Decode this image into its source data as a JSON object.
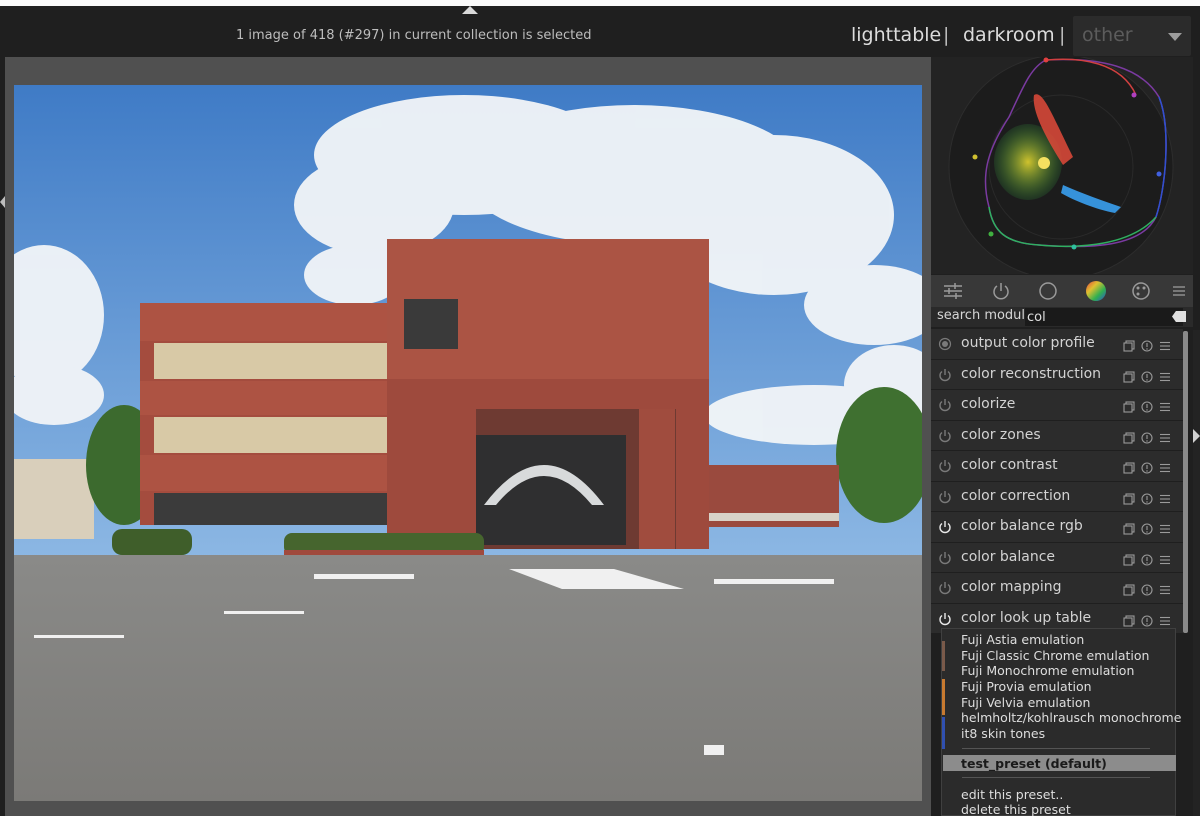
{
  "header": {
    "selection_status": "1 image of 418 (#297) in current collection is selected",
    "views": {
      "lighttable": "lighttable",
      "separator": "|",
      "darkroom": "darkroom",
      "other": "other"
    }
  },
  "photo": {
    "subject": "brick building photo"
  },
  "histogram": {
    "type": "vectorscope"
  },
  "module_groups": {
    "icons": [
      "sliders-icon",
      "power-icon",
      "circle-icon",
      "color-wheel-icon",
      "palette-icon",
      "menu-icon"
    ]
  },
  "search": {
    "label": "search module",
    "value": "col"
  },
  "modules": [
    {
      "name": "output color profile",
      "enabled": true,
      "always_on": true
    },
    {
      "name": "color reconstruction",
      "enabled": false
    },
    {
      "name": "colorize",
      "enabled": false
    },
    {
      "name": "color zones",
      "enabled": false
    },
    {
      "name": "color contrast",
      "enabled": false
    },
    {
      "name": "color correction",
      "enabled": false
    },
    {
      "name": "color balance rgb",
      "enabled": true
    },
    {
      "name": "color balance",
      "enabled": false
    },
    {
      "name": "color mapping",
      "enabled": false
    },
    {
      "name": "color look up table",
      "enabled": true
    }
  ],
  "preset_menu": {
    "items": [
      "Fuji Astia emulation",
      "Fuji Classic Chrome emulation",
      "Fuji Monochrome emulation",
      "Fuji Provia emulation",
      "Fuji Velvia emulation",
      "helmholtz/kohlrausch monochrome",
      "it8 skin tones"
    ],
    "selected": "test_preset (default)",
    "actions": [
      "edit this preset..",
      "delete this preset"
    ]
  },
  "colors": {
    "background": "#1f1f1f",
    "panel": "#2c2c2c",
    "center": "#505050",
    "selected_preset": "#8c8c8c"
  }
}
